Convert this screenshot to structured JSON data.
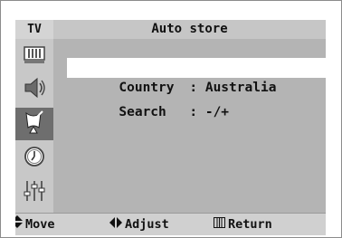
{
  "header": {
    "mode": "TV",
    "title": "Auto store"
  },
  "sidebar": {
    "items": [
      {
        "icon": "picture-icon"
      },
      {
        "icon": "sound-icon"
      },
      {
        "icon": "channel-icon",
        "active": true
      },
      {
        "icon": "clock-icon"
      },
      {
        "icon": "setup-icon"
      }
    ]
  },
  "menu": {
    "rows": [
      {
        "label": "Country",
        "value": ": Australia",
        "highlighted": true
      },
      {
        "label": "Search",
        "value": ": -/+",
        "highlighted": false
      }
    ]
  },
  "footer": {
    "move_label": "Move",
    "adjust_label": "Adjust",
    "return_label": "Return"
  },
  "colors": {
    "panel": "#b4b4b4",
    "highlight": "#ffffff",
    "active_icon_bg": "#6e6e6e"
  }
}
